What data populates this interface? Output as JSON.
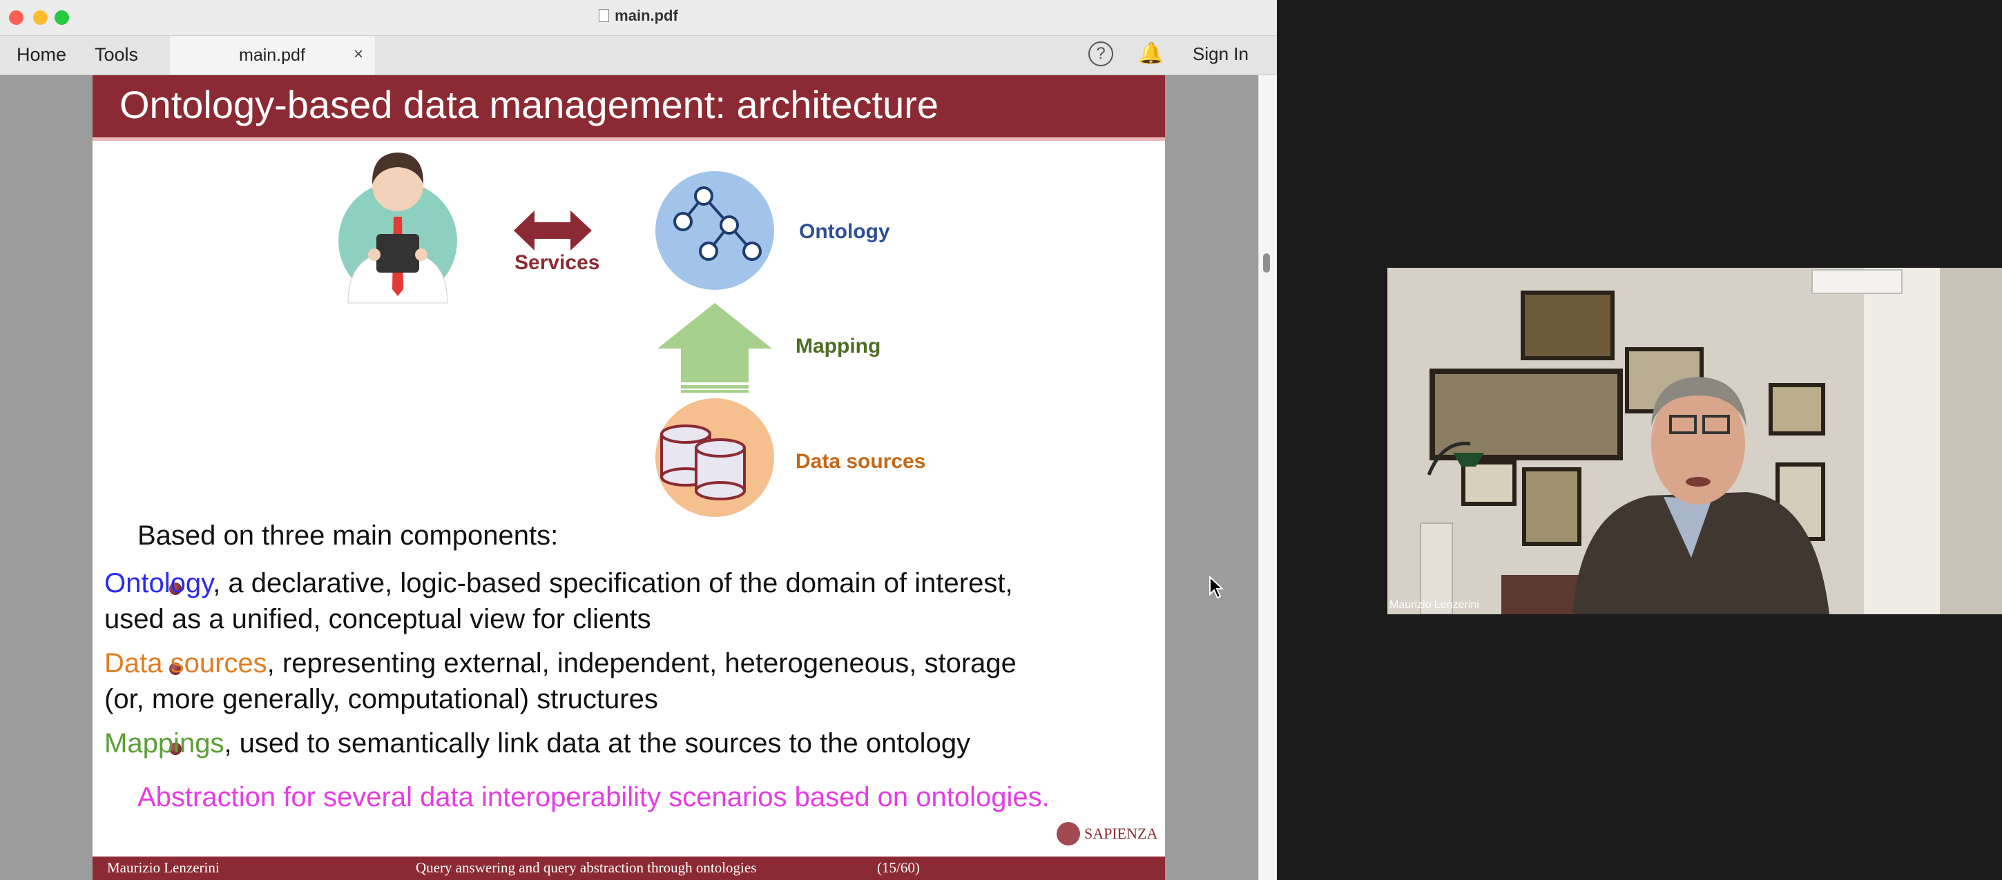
{
  "window": {
    "title": "main.pdf"
  },
  "toolbar": {
    "home": "Home",
    "tools": "Tools",
    "tab_label": "main.pdf",
    "tab_close": "×",
    "help": "?",
    "sign_in": "Sign In"
  },
  "slide": {
    "title": "Ontology-based data management: architecture",
    "diagram": {
      "services": "Services",
      "ontology": "Ontology",
      "mapping": "Mapping",
      "data_sources": "Data sources"
    },
    "intro": "Based on three main components:",
    "bullets": [
      {
        "term": "Ontology",
        "line1": ", a declarative, logic-based specification of the domain of interest,",
        "line2": "used as a unified, conceptual view for clients"
      },
      {
        "term": "Data sources",
        "line1": ", representing external, independent, heterogeneous, storage",
        "line2": "(or, more generally, computational) structures"
      },
      {
        "term": "Mappings",
        "line1": ", used to semantically link data at the sources to the ontology"
      }
    ],
    "abstraction": "Abstraction for several data interoperability scenarios based on ontologies.",
    "logo_text": "SAPIENZA",
    "footer": {
      "author": "Maurizio Lenzerini",
      "talk": "Query answering and query abstraction through ontologies",
      "page": "(15/60)"
    }
  },
  "video": {
    "participant": "Maurizio Lenzerini"
  },
  "colors": {
    "header": "#8c2a33",
    "ontology": "#2a2af0",
    "data_sources": "#e37d22",
    "mappings": "#5aa036",
    "abstraction": "#e63ce6"
  }
}
